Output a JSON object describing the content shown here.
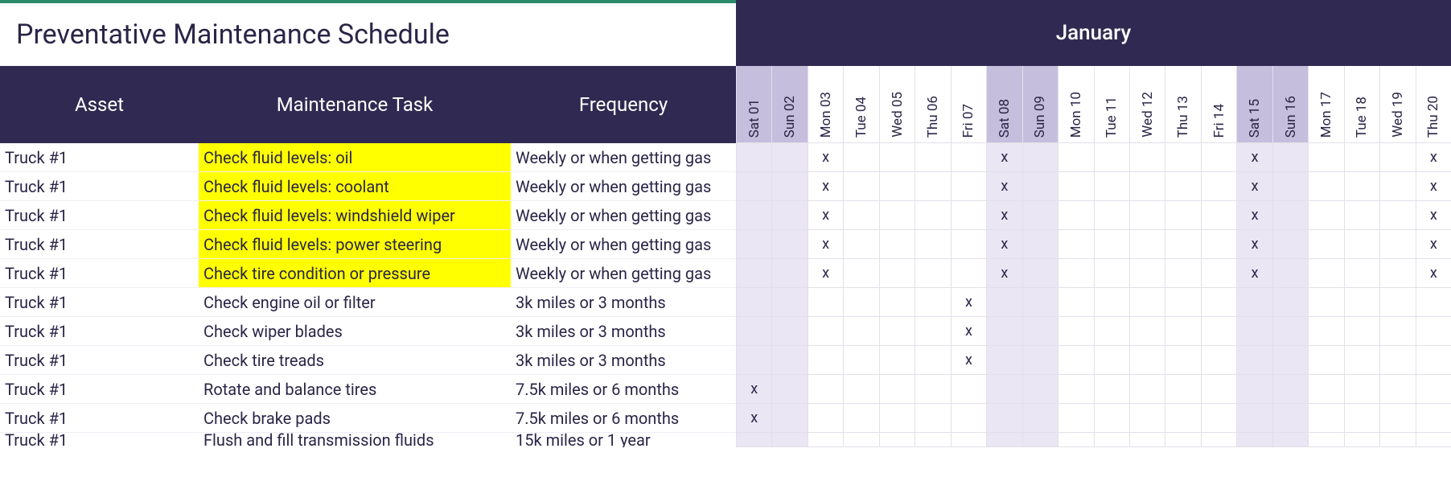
{
  "title": "Preventative Maintenance Schedule",
  "month": "January",
  "columns": {
    "asset": "Asset",
    "task": "Maintenance Task",
    "frequency": "Frequency"
  },
  "dates": [
    {
      "label": "Sat 01",
      "weekend": true
    },
    {
      "label": "Sun 02",
      "weekend": true
    },
    {
      "label": "Mon 03",
      "weekend": false
    },
    {
      "label": "Tue 04",
      "weekend": false
    },
    {
      "label": "Wed 05",
      "weekend": false
    },
    {
      "label": "Thu 06",
      "weekend": false
    },
    {
      "label": "Fri 07",
      "weekend": false
    },
    {
      "label": "Sat 08",
      "weekend": true
    },
    {
      "label": "Sun 09",
      "weekend": true
    },
    {
      "label": "Mon 10",
      "weekend": false
    },
    {
      "label": "Tue 11",
      "weekend": false
    },
    {
      "label": "Wed 12",
      "weekend": false
    },
    {
      "label": "Thu 13",
      "weekend": false
    },
    {
      "label": "Fri 14",
      "weekend": false
    },
    {
      "label": "Sat 15",
      "weekend": true
    },
    {
      "label": "Sun 16",
      "weekend": true
    },
    {
      "label": "Mon 17",
      "weekend": false
    },
    {
      "label": "Tue 18",
      "weekend": false
    },
    {
      "label": "Wed 19",
      "weekend": false
    },
    {
      "label": "Thu 20",
      "weekend": false
    }
  ],
  "rows": [
    {
      "asset": "Truck #1",
      "task": "Check fluid levels: oil",
      "freq": "Weekly or when getting gas",
      "hl": true,
      "marks": [
        "",
        "",
        "x",
        "",
        "",
        "",
        "",
        "x",
        "",
        "",
        "",
        "",
        "",
        "",
        "x",
        "",
        "",
        "",
        "",
        "x"
      ]
    },
    {
      "asset": "Truck #1",
      "task": "Check fluid levels: coolant",
      "freq": "Weekly or when getting gas",
      "hl": true,
      "marks": [
        "",
        "",
        "x",
        "",
        "",
        "",
        "",
        "x",
        "",
        "",
        "",
        "",
        "",
        "",
        "x",
        "",
        "",
        "",
        "",
        "x"
      ]
    },
    {
      "asset": "Truck #1",
      "task": "Check fluid levels: windshield wiper",
      "freq": "Weekly or when getting gas",
      "hl": true,
      "marks": [
        "",
        "",
        "x",
        "",
        "",
        "",
        "",
        "x",
        "",
        "",
        "",
        "",
        "",
        "",
        "x",
        "",
        "",
        "",
        "",
        "x"
      ]
    },
    {
      "asset": "Truck #1",
      "task": "Check fluid levels: power steering",
      "freq": "Weekly or when getting gas",
      "hl": true,
      "marks": [
        "",
        "",
        "x",
        "",
        "",
        "",
        "",
        "x",
        "",
        "",
        "",
        "",
        "",
        "",
        "x",
        "",
        "",
        "",
        "",
        "x"
      ]
    },
    {
      "asset": "Truck #1",
      "task": "Check tire condition or pressure",
      "freq": "Weekly or when getting gas",
      "hl": true,
      "marks": [
        "",
        "",
        "x",
        "",
        "",
        "",
        "",
        "x",
        "",
        "",
        "",
        "",
        "",
        "",
        "x",
        "",
        "",
        "",
        "",
        "x"
      ]
    },
    {
      "asset": "Truck #1",
      "task": "Check engine oil or filter",
      "freq": "3k miles or 3 months",
      "hl": false,
      "marks": [
        "",
        "",
        "",
        "",
        "",
        "",
        "x",
        "",
        "",
        "",
        "",
        "",
        "",
        "",
        "",
        "",
        "",
        "",
        "",
        ""
      ]
    },
    {
      "asset": "Truck #1",
      "task": "Check wiper blades",
      "freq": "3k miles or 3 months",
      "hl": false,
      "marks": [
        "",
        "",
        "",
        "",
        "",
        "",
        "x",
        "",
        "",
        "",
        "",
        "",
        "",
        "",
        "",
        "",
        "",
        "",
        "",
        ""
      ]
    },
    {
      "asset": "Truck #1",
      "task": "Check tire treads",
      "freq": "3k miles or 3 months",
      "hl": false,
      "marks": [
        "",
        "",
        "",
        "",
        "",
        "",
        "x",
        "",
        "",
        "",
        "",
        "",
        "",
        "",
        "",
        "",
        "",
        "",
        "",
        ""
      ]
    },
    {
      "asset": "Truck #1",
      "task": "Rotate and balance tires",
      "freq": "7.5k miles or 6 months",
      "hl": false,
      "marks": [
        "x",
        "",
        "",
        "",
        "",
        "",
        "",
        "",
        "",
        "",
        "",
        "",
        "",
        "",
        "",
        "",
        "",
        "",
        "",
        ""
      ]
    },
    {
      "asset": "Truck #1",
      "task": "Check brake pads",
      "freq": "7.5k miles or 6 months",
      "hl": false,
      "marks": [
        "x",
        "",
        "",
        "",
        "",
        "",
        "",
        "",
        "",
        "",
        "",
        "",
        "",
        "",
        "",
        "",
        "",
        "",
        "",
        ""
      ]
    }
  ],
  "partial_row": {
    "asset": "Truck #1",
    "task": "Flush and fill transmission fluids",
    "freq": "15k miles or 1 year"
  }
}
